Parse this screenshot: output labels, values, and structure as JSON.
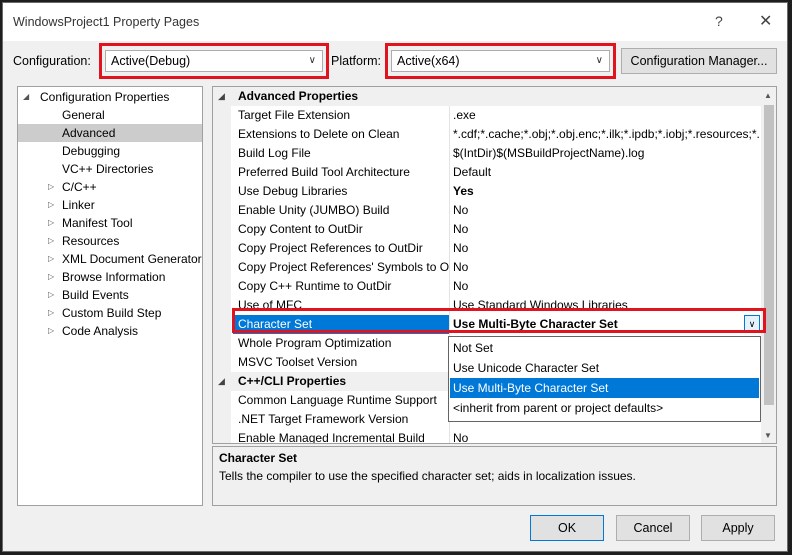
{
  "window": {
    "title": "WindowsProject1 Property Pages",
    "help_glyph": "?",
    "close_glyph": "✕"
  },
  "toolbar": {
    "configuration_label": "Configuration:",
    "configuration_value": "Active(Debug)",
    "platform_label": "Platform:",
    "platform_value": "Active(x64)",
    "config_manager_label": "Configuration Manager..."
  },
  "tree": {
    "root": "Configuration Properties",
    "items": [
      "General",
      "Advanced",
      "Debugging",
      "VC++ Directories",
      "C/C++",
      "Linker",
      "Manifest Tool",
      "Resources",
      "XML Document Generator",
      "Browse Information",
      "Build Events",
      "Custom Build Step",
      "Code Analysis"
    ],
    "selected": "Advanced"
  },
  "grid": {
    "category1": "Advanced Properties",
    "rows": [
      {
        "name": "Target File Extension",
        "value": ".exe"
      },
      {
        "name": "Extensions to Delete on Clean",
        "value": "*.cdf;*.cache;*.obj;*.obj.enc;*.ilk;*.ipdb;*.iobj;*.resources;*.t"
      },
      {
        "name": "Build Log File",
        "value": "$(IntDir)$(MSBuildProjectName).log"
      },
      {
        "name": "Preferred Build Tool Architecture",
        "value": "Default"
      },
      {
        "name": "Use Debug Libraries",
        "value": "Yes"
      },
      {
        "name": "Enable Unity (JUMBO) Build",
        "value": "No"
      },
      {
        "name": "Copy Content to OutDir",
        "value": "No"
      },
      {
        "name": "Copy Project References to OutDir",
        "value": "No"
      },
      {
        "name": "Copy Project References' Symbols to Ou",
        "value": "No"
      },
      {
        "name": "Copy C++ Runtime to OutDir",
        "value": "No"
      },
      {
        "name": "Use of MFC",
        "value": "Use Standard Windows Libraries"
      },
      {
        "name": "Character Set",
        "value": "Use Multi-Byte Character Set"
      },
      {
        "name": "Whole Program Optimization",
        "value": ""
      },
      {
        "name": "MSVC Toolset Version",
        "value": ""
      }
    ],
    "category2": "C++/CLI Properties",
    "rows2": [
      {
        "name": "Common Language Runtime Support",
        "value": ""
      },
      {
        "name": ".NET Target Framework Version",
        "value": ""
      },
      {
        "name": "Enable Managed Incremental Build",
        "value": "No"
      }
    ]
  },
  "dropdown": {
    "options": [
      "Not Set",
      "Use Unicode Character Set",
      "Use Multi-Byte Character Set",
      "<inherit from parent or project defaults>"
    ],
    "selected": "Use Multi-Byte Character Set"
  },
  "description": {
    "title": "Character Set",
    "text": "Tells the compiler to use the specified character set; aids in localization issues."
  },
  "buttons": {
    "ok": "OK",
    "cancel": "Cancel",
    "apply": "Apply"
  },
  "colors": {
    "accent": "#0078d7",
    "highlight_box": "#e0141e"
  }
}
